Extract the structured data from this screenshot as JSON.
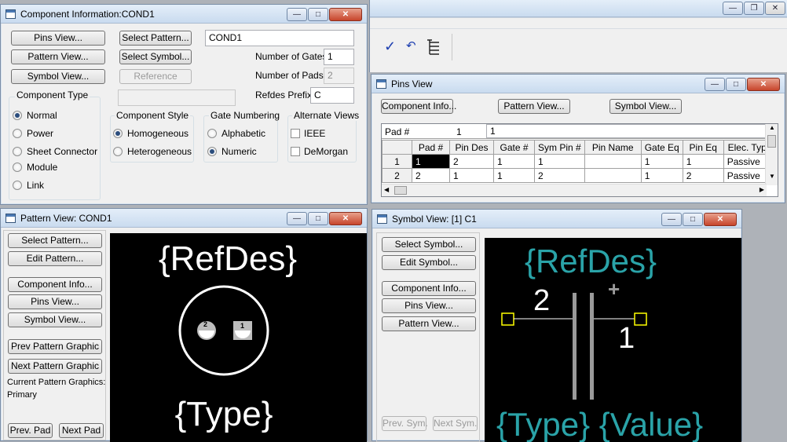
{
  "main_toolbar": {
    "check_icon": "checkmark-icon",
    "undo_icon": "undo-icon",
    "tree_icon": "hierarchy-icon"
  },
  "component_info": {
    "title": "Component Information:COND1",
    "buttons": {
      "pins_view": "Pins View...",
      "pattern_view": "Pattern View...",
      "symbol_view": "Symbol View...",
      "select_pattern": "Select Pattern...",
      "select_symbol": "Select Symbol...",
      "reference": "Reference"
    },
    "component_name": "COND1",
    "number_of_gates_label": "Number of Gates:",
    "number_of_gates": "1",
    "number_of_pads_label": "Number of Pads:",
    "number_of_pads": "2",
    "refdes_prefix_label": "Refdes Prefix:",
    "refdes_prefix": "C",
    "component_type": {
      "label": "Component Type",
      "options": [
        "Normal",
        "Power",
        "Sheet Connector",
        "Module",
        "Link"
      ],
      "selected": "Normal"
    },
    "component_style": {
      "label": "Component Style",
      "options": [
        "Homogeneous",
        "Heterogeneous"
      ],
      "selected": "Homogeneous"
    },
    "gate_numbering": {
      "label": "Gate Numbering",
      "options": [
        "Alphabetic",
        "Numeric"
      ],
      "selected": "Numeric"
    },
    "alternate_views": {
      "label": "Alternate Views",
      "options": [
        "IEEE",
        "DeMorgan"
      ]
    }
  },
  "pins_view": {
    "title": "Pins View",
    "buttons": {
      "component_info": "Component Info...",
      "pattern_view": "Pattern View...",
      "symbol_view": "Symbol View..."
    },
    "edit_row": {
      "label": "Pad #",
      "col": "1",
      "value": "1"
    },
    "columns": [
      "Pad #",
      "Pin Des",
      "Gate #",
      "Sym Pin #",
      "Pin Name",
      "Gate Eq",
      "Pin Eq",
      "Elec. Typ"
    ],
    "rows": [
      {
        "row": "1",
        "cells": [
          "1",
          "2",
          "1",
          "1",
          "",
          "1",
          "1",
          "Passive"
        ]
      },
      {
        "row": "2",
        "cells": [
          "2",
          "1",
          "1",
          "2",
          "",
          "1",
          "2",
          "Passive"
        ]
      }
    ]
  },
  "pattern_view": {
    "title": "Pattern View: COND1",
    "buttons": {
      "select_pattern": "Select Pattern...",
      "edit_pattern": "Edit Pattern...",
      "component_info": "Component Info...",
      "pins_view": "Pins View...",
      "symbol_view": "Symbol View...",
      "prev_graphic": "Prev Pattern Graphic",
      "next_graphic": "Next Pattern Graphic",
      "prev_pad": "Prev. Pad",
      "next_pad": "Next Pad"
    },
    "current_graphics_label": "Current Pattern Graphics:",
    "current_graphics_value": "Primary",
    "canvas": {
      "refdes": "{RefDes}",
      "type": "{Type}",
      "pad_left": "2",
      "pad_right": "1"
    }
  },
  "symbol_view": {
    "title": "Symbol View: [1] C1",
    "buttons": {
      "select_symbol": "Select Symbol...",
      "edit_symbol": "Edit Symbol...",
      "component_info": "Component Info...",
      "pins_view": "Pins View...",
      "pattern_view": "Pattern View...",
      "prev_sym": "Prev. Sym.",
      "next_sym": "Next Sym."
    },
    "canvas": {
      "refdes": "{RefDes}",
      "type": "{Type}",
      "value": "{Value}",
      "pin_left": "2",
      "pin_right": "1",
      "plus": "+"
    }
  }
}
